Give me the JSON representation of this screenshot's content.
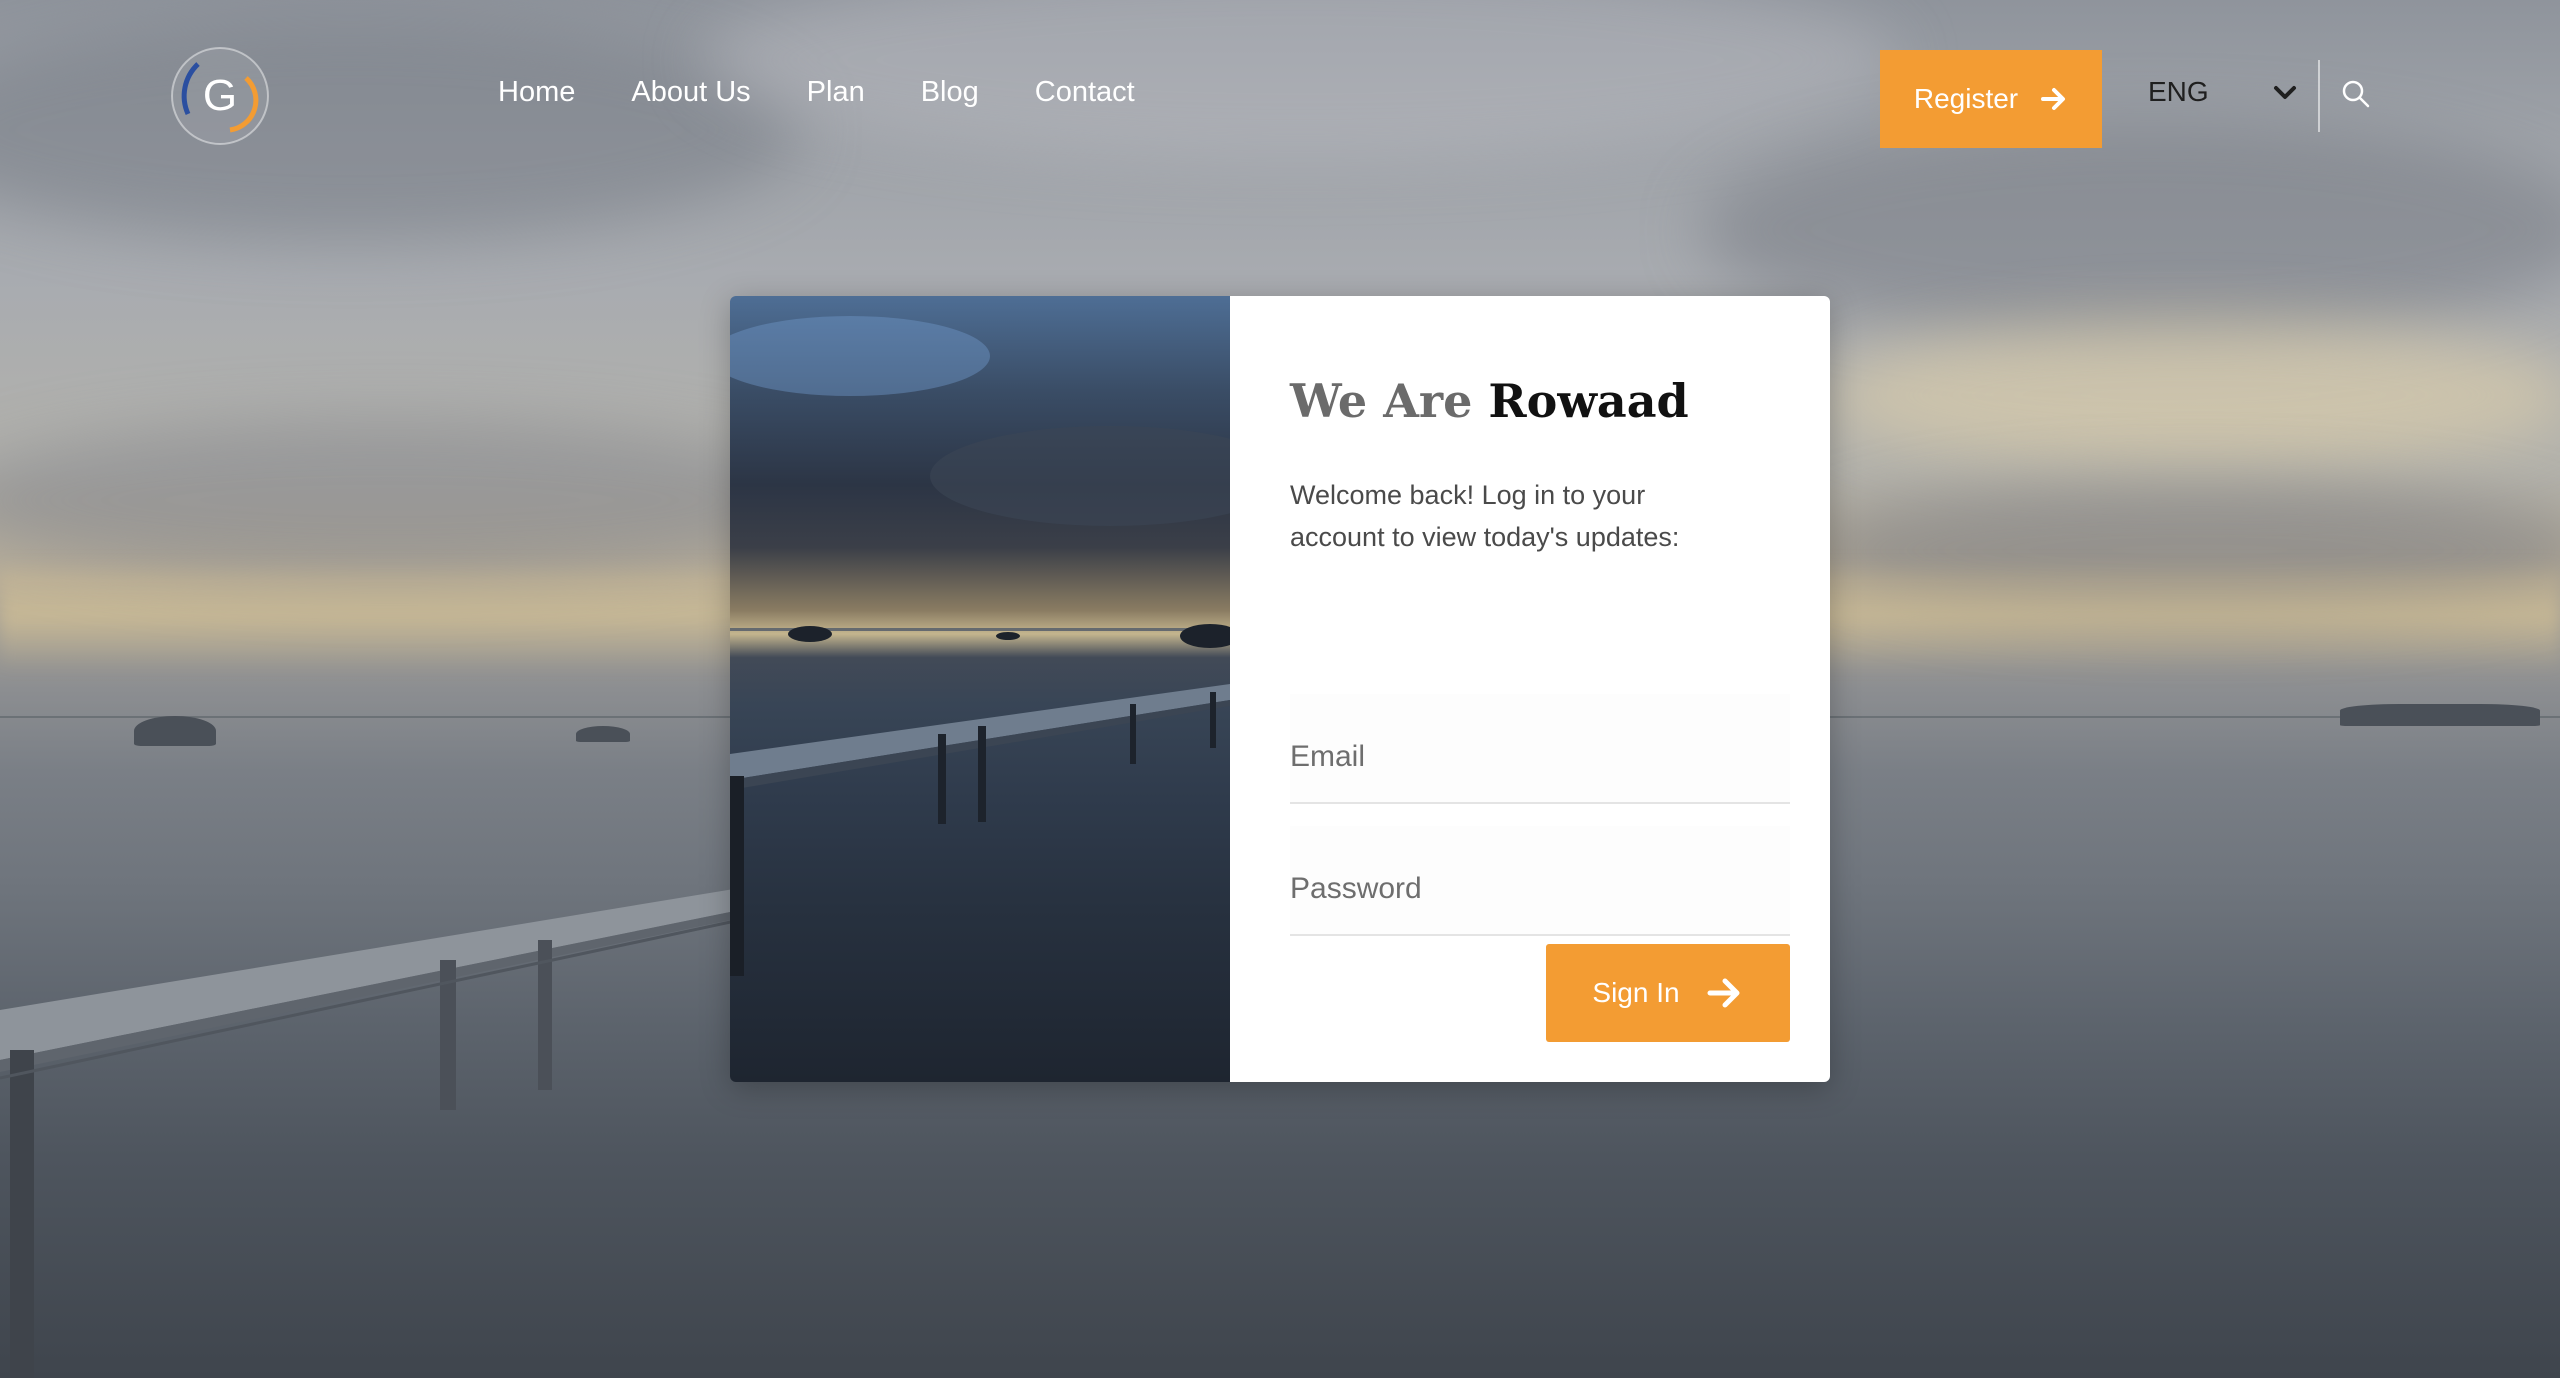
{
  "header": {
    "logo_letter": "G",
    "nav": [
      {
        "label": "Home"
      },
      {
        "label": "About Us"
      },
      {
        "label": "Plan"
      },
      {
        "label": "Blog"
      },
      {
        "label": "Contact"
      }
    ],
    "register_label": "Register",
    "language": "ENG"
  },
  "login": {
    "title_muted": "We Are",
    "title_strong": "Rowaad",
    "subtitle": "Welcome back! Log in to your account to view today's updates:",
    "email_placeholder": "Email",
    "password_placeholder": "Password",
    "signin_label": "Sign In"
  },
  "colors": {
    "accent": "#f39c33",
    "nav_text": "#ffffff",
    "title_muted": "#6b6b6b",
    "title_strong": "#111111"
  },
  "icons": {
    "register": "arrow-right-icon",
    "language": "chevron-down-icon",
    "search": "search-icon",
    "signin": "arrow-right-icon"
  }
}
